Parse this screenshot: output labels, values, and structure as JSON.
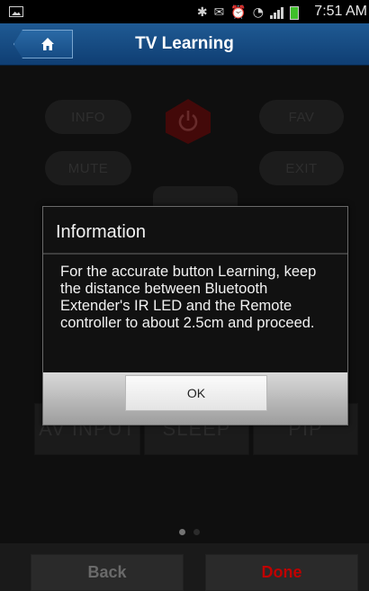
{
  "status_bar": {
    "time": "7:51 AM",
    "icons": [
      "image-icon",
      "bluetooth-icon",
      "missed-call-icon",
      "alarm-icon",
      "wifi-icon",
      "signal-icon",
      "battery-icon"
    ]
  },
  "header": {
    "title": "TV Learning",
    "home_icon": "home-icon"
  },
  "remote": {
    "buttons": {
      "info": "INFO",
      "fav": "FAV",
      "mute": "MUTE",
      "exit": "EXIT",
      "av_input": "AV INPUT",
      "sleep": "SLEEP",
      "pip": "PIP"
    },
    "power_color": "#c01818",
    "page_indicator": {
      "current": 1,
      "total": 2
    }
  },
  "footer": {
    "back_label": "Back",
    "done_label": "Done",
    "done_color": "#c00000"
  },
  "dialog": {
    "title": "Information",
    "message": "For the accurate button Learning, keep the distance between Bluetooth Extender's IR LED and the Remote controller to about 2.5cm and proceed.",
    "ok_label": "OK"
  }
}
